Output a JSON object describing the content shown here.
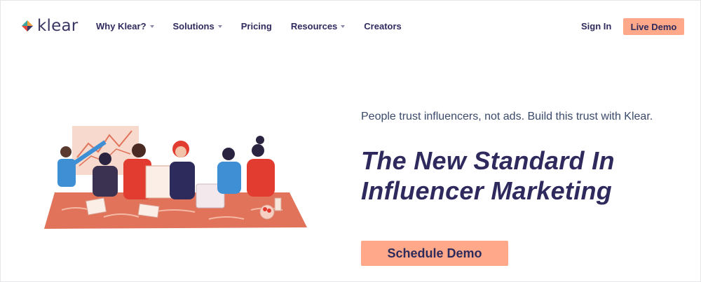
{
  "brand": {
    "name": "klear"
  },
  "nav": {
    "items": [
      {
        "label": "Why Klear?",
        "dropdown": true
      },
      {
        "label": "Solutions",
        "dropdown": true
      },
      {
        "label": "Pricing",
        "dropdown": false
      },
      {
        "label": "Resources",
        "dropdown": true
      },
      {
        "label": "Creators",
        "dropdown": false
      }
    ],
    "sign_in": "Sign In",
    "live_demo": "Live Demo"
  },
  "hero": {
    "tagline": "People trust influencers, not ads. Build this trust with Klear.",
    "headline_line1": "The New Standard In",
    "headline_line2": "Influencer Marketing",
    "cta": "Schedule Demo",
    "illustration_icon": "team-meeting-illustration"
  },
  "colors": {
    "accent": "#ffa98a",
    "navy": "#2f2a5e",
    "rug": "#e0735a",
    "red": "#e23b30",
    "blue": "#3f8fd4"
  }
}
